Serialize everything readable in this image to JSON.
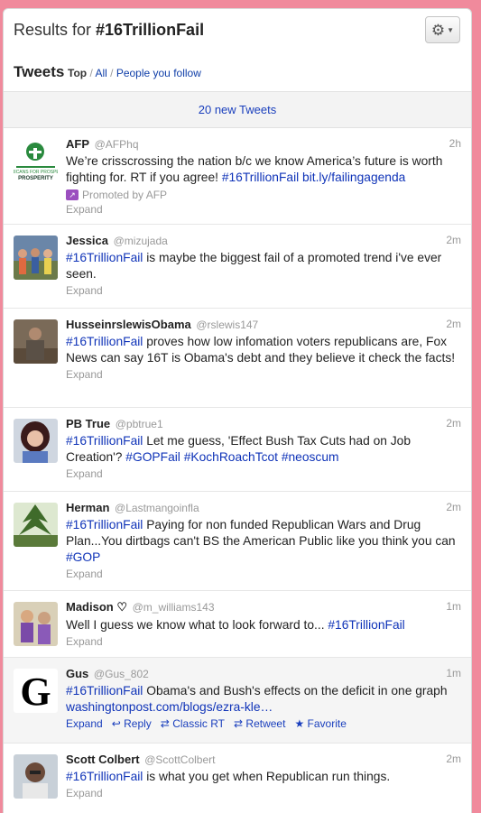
{
  "header": {
    "title_prefix": "Results for ",
    "title_query": "#16TrillionFail",
    "tweets_label": "Tweets",
    "filter_top": "Top",
    "filter_sep1": " / ",
    "filter_all": "All",
    "filter_sep2": " / ",
    "filter_follow": "People you follow"
  },
  "new_tweets": "20 new Tweets",
  "tweets": [
    {
      "name": "AFP",
      "handle": "@AFPhq",
      "time": "2h",
      "text_parts": [
        {
          "t": "We’re crisscrossing the nation b/c we know America’s future is worth fighting for. RT if you agree! ",
          "tag": false
        },
        {
          "t": "#16TrillionFail bit.ly/failingagenda",
          "tag": true
        }
      ],
      "promo": "Promoted by AFP",
      "expand": "Expand"
    },
    {
      "name": "Jessica",
      "handle": "@mizujada",
      "time": "2m",
      "text_parts": [
        {
          "t": "#16TrillionFail",
          "tag": true
        },
        {
          "t": " is maybe the biggest fail of a promoted trend i've ever seen.",
          "tag": false
        }
      ],
      "expand": "Expand"
    },
    {
      "name": "HusseinrslewisObama",
      "handle": "@rslewis147",
      "time": "2m",
      "text_parts": [
        {
          "t": "#16TrillionFail",
          "tag": true
        },
        {
          "t": " proves how low infomation voters republicans are, Fox News can say 16T is Obama's debt and they believe it check the facts!",
          "tag": false
        }
      ],
      "expand": "Expand"
    },
    {
      "name": "PB True",
      "handle": "@pbtrue1",
      "time": "2m",
      "text_parts": [
        {
          "t": "#16TrillionFail",
          "tag": true
        },
        {
          "t": " Let me guess, 'Effect Bush Tax Cuts had on Job Creation'? ",
          "tag": false
        },
        {
          "t": "#GOPFail #KochRoachTcot #neoscum",
          "tag": true
        }
      ],
      "expand": "Expand"
    },
    {
      "name": "Herman",
      "handle": "@Lastmangoinfla",
      "time": "2m",
      "text_parts": [
        {
          "t": "#16TrillionFail",
          "tag": true
        },
        {
          "t": " Paying for non funded Republican Wars and Drug Plan...You dirtbags can't BS the American Public like you think you can ",
          "tag": false
        },
        {
          "t": "#GOP",
          "tag": true
        }
      ],
      "expand": "Expand"
    },
    {
      "name": "Madison ♡",
      "handle": "@m_williams143",
      "time": "1m",
      "text_parts": [
        {
          "t": "Well I guess we know what to look forward to... ",
          "tag": false
        },
        {
          "t": "#16TrillionFail",
          "tag": true
        }
      ],
      "expand": "Expand"
    },
    {
      "name": "Gus",
      "handle": "@Gus_802",
      "time": "1m",
      "text_parts": [
        {
          "t": "#16TrillionFail",
          "tag": true
        },
        {
          "t": " Obama's and Bush's effects on the deficit in one graph ",
          "tag": false
        },
        {
          "t": "washingtonpost.com/blogs/ezra-kle…",
          "tag": true
        }
      ],
      "expand": "Expand",
      "actions": {
        "reply": "Reply",
        "classic_rt": "Classic RT",
        "retweet": "Retweet",
        "favorite": "Favorite"
      }
    },
    {
      "name": "Scott Colbert",
      "handle": "@ScottColbert",
      "time": "2m",
      "text_parts": [
        {
          "t": "#16TrillionFail",
          "tag": true
        },
        {
          "t": " is what you get when Republican run things.",
          "tag": false
        }
      ],
      "expand": "Expand"
    }
  ],
  "afp_logo_text": "AMERICANS FOR PROSPERITY",
  "gus_logo_letter": "G",
  "icons": {
    "gear": "gear-icon",
    "caret": "caret-down-icon",
    "reply": "reply-icon",
    "retweet": "retweet-icon",
    "favorite": "star-icon",
    "promoted": "promoted-icon"
  }
}
